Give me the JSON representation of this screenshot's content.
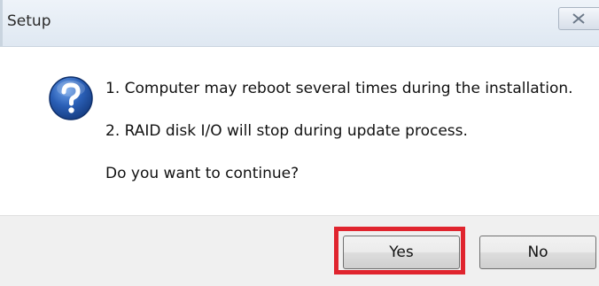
{
  "window": {
    "title": "Setup"
  },
  "message": {
    "line1": "1. Computer may reboot several times during the installation.",
    "line2": "2. RAID disk I/O will stop during update process.",
    "line3": "Do you want to continue?"
  },
  "buttons": {
    "yes_label": "Yes",
    "no_label": "No"
  },
  "icons": {
    "dialog_icon": "question-icon",
    "close_icon": "close-icon"
  },
  "colors": {
    "highlight": "#e0242e",
    "icon_blue": "#2a5fb6"
  }
}
